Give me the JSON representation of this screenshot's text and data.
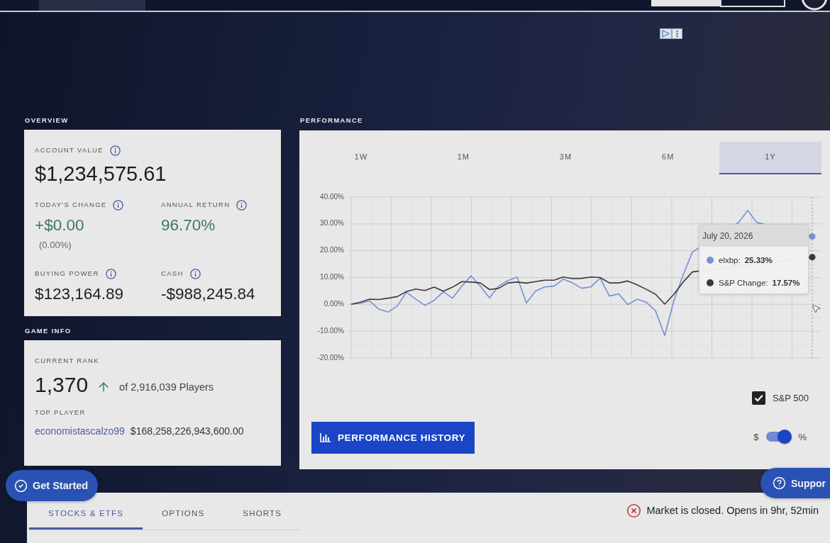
{
  "overview": {
    "title": "OVERVIEW",
    "account_value": {
      "label": "ACCOUNT VALUE",
      "value": "$1,234,575.61",
      "info": true
    },
    "stats": [
      {
        "label": "TODAY'S CHANGE",
        "value": "+$0.00",
        "note": "(0.00%)",
        "color": "#3d7a5a",
        "info": true
      },
      {
        "label": "ANNUAL RETURN",
        "value": "96.70%",
        "color": "#3d7a5a",
        "info": true
      },
      {
        "label": "BUYING POWER",
        "value": "$123,164.89",
        "color": "#1f1f1f",
        "info": true
      },
      {
        "label": "CASH",
        "value": "-$988,245.84",
        "color": "#1f1f1f",
        "info": true
      }
    ]
  },
  "game_info": {
    "title": "GAME INFO",
    "rank_label": "CURRENT RANK",
    "rank": "1,370",
    "rank_total": "of 2,916,039 Players",
    "top_player_label": "TOP PLAYER",
    "top_player": {
      "name": "economistascalzo99",
      "value": "$168,258,226,943,600.00"
    }
  },
  "performance": {
    "title": "PERFORMANCE",
    "ranges": [
      {
        "label": "1W",
        "selected": false
      },
      {
        "label": "1M",
        "selected": false
      },
      {
        "label": "3M",
        "selected": false
      },
      {
        "label": "6M",
        "selected": false
      },
      {
        "label": "1Y",
        "selected": true
      }
    ],
    "chart_data": {
      "type": "line",
      "grid": true,
      "ylim": [
        -20,
        40
      ],
      "yticks": [
        {
          "value": -20,
          "label": "-20.00%"
        },
        {
          "value": -10,
          "label": "-10.00%"
        },
        {
          "value": 0,
          "label": "0.00%"
        },
        {
          "value": 10,
          "label": "10.00%"
        },
        {
          "value": 20,
          "label": "20.00%"
        },
        {
          "value": 30,
          "label": "30.00%"
        },
        {
          "value": 40,
          "label": "40.00%"
        }
      ],
      "series": [
        {
          "color": "#7393d6",
          "values": [
            0,
            0.4,
            1.3,
            -1.8,
            -2.9,
            -0.6,
            4.5,
            2.0,
            -0.4,
            1.5,
            4.7,
            2.3,
            6.8,
            10.6,
            6.8,
            2.4,
            6.8,
            8.9,
            10.2,
            0.5,
            5.0,
            6.5,
            6.8,
            9.4,
            8.0,
            6.0,
            6.5,
            9.8,
            3.1,
            3.9,
            -0.1,
            1.9,
            0.8,
            -2.4,
            -11.6,
            1.4,
            11.0,
            19.5,
            null,
            null,
            null,
            null,
            30.5,
            35.0,
            30.5,
            null,
            null,
            null,
            null,
            null,
            25.3
          ]
        },
        {
          "color": "#3a3a3a",
          "values": [
            0,
            0.8,
            1.9,
            1.8,
            2.3,
            2.9,
            4.8,
            5.7,
            5.2,
            6.4,
            4.9,
            6.4,
            8.5,
            8.3,
            8.0,
            5.5,
            6.0,
            8.0,
            8.3,
            7.9,
            8.5,
            9.0,
            9.0,
            10.2,
            9.6,
            9.7,
            10.2,
            10.0,
            8.0,
            8.0,
            8.7,
            7.3,
            5.6,
            3.8,
            0.1,
            3.8,
            8.3,
            12.1,
            null,
            null,
            null,
            null,
            null,
            null,
            null,
            null,
            null,
            null,
            null,
            null,
            17.6
          ]
        }
      ]
    },
    "tooltip": {
      "date": "July 20, 2026",
      "items": [
        {
          "label": "elxbp:",
          "value": "25.33%"
        },
        {
          "label": "S&P Change:",
          "value": "17.57%"
        }
      ]
    },
    "history_button": "PERFORMANCE HISTORY",
    "benchmark": {
      "label": "S&P 500",
      "checked": true
    },
    "unit_switch": {
      "left": "$",
      "right": "%",
      "on": true
    }
  },
  "floating_buttons": [
    {
      "kind": "get-started",
      "label": "Get Started"
    },
    {
      "kind": "support",
      "label": "Suppor"
    }
  ],
  "trade_tabs": [
    {
      "label": "STOCKS & ETFS",
      "selected": true
    },
    {
      "label": "OPTIONS",
      "selected": false
    },
    {
      "label": "SHORTS",
      "selected": false
    }
  ],
  "market_status": {
    "text": "Market is closed. Opens in 9hr, 52min",
    "open": false
  }
}
